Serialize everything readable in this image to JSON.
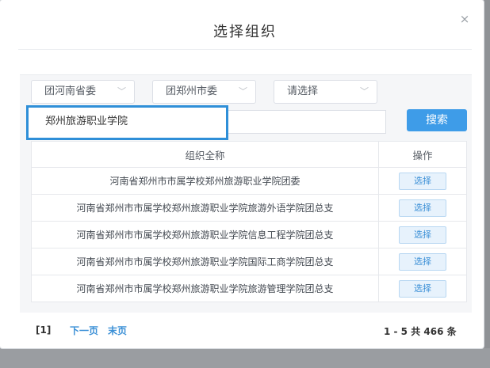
{
  "dialog": {
    "title": "选择组织",
    "close_icon": "close-icon",
    "close_glyph": "×"
  },
  "filters": {
    "province": "团河南省委",
    "city": "团郑州市委",
    "third": "请选择",
    "chevron_icon": "chevron-down-icon",
    "chevron_glyph": "﹀"
  },
  "search": {
    "value": "郑州旅游职业学院",
    "button_label": "搜索"
  },
  "table": {
    "headers": [
      "组织全称",
      "操作"
    ],
    "rows": [
      {
        "name": "河南省郑州市市属学校郑州旅游职业学院团委",
        "action": "选择"
      },
      {
        "name": "河南省郑州市市属学校郑州旅游职业学院旅游外语学院团总支",
        "action": "选择"
      },
      {
        "name": "河南省郑州市市属学校郑州旅游职业学院信息工程学院团总支",
        "action": "选择"
      },
      {
        "name": "河南省郑州市市属学校郑州旅游职业学院国际工商学院团总支",
        "action": "选择"
      },
      {
        "name": "河南省郑州市市属学校郑州旅游职业学院旅游管理学院团总支",
        "action": "选择"
      }
    ]
  },
  "pagination": {
    "current": "[1]",
    "next": "下一页",
    "last": "末页",
    "summary": "1 - 5  共 466 条"
  },
  "colors": {
    "accent": "#3e9ce8",
    "highlight_border": "#2f8fd8",
    "link": "#3a8fd6"
  }
}
